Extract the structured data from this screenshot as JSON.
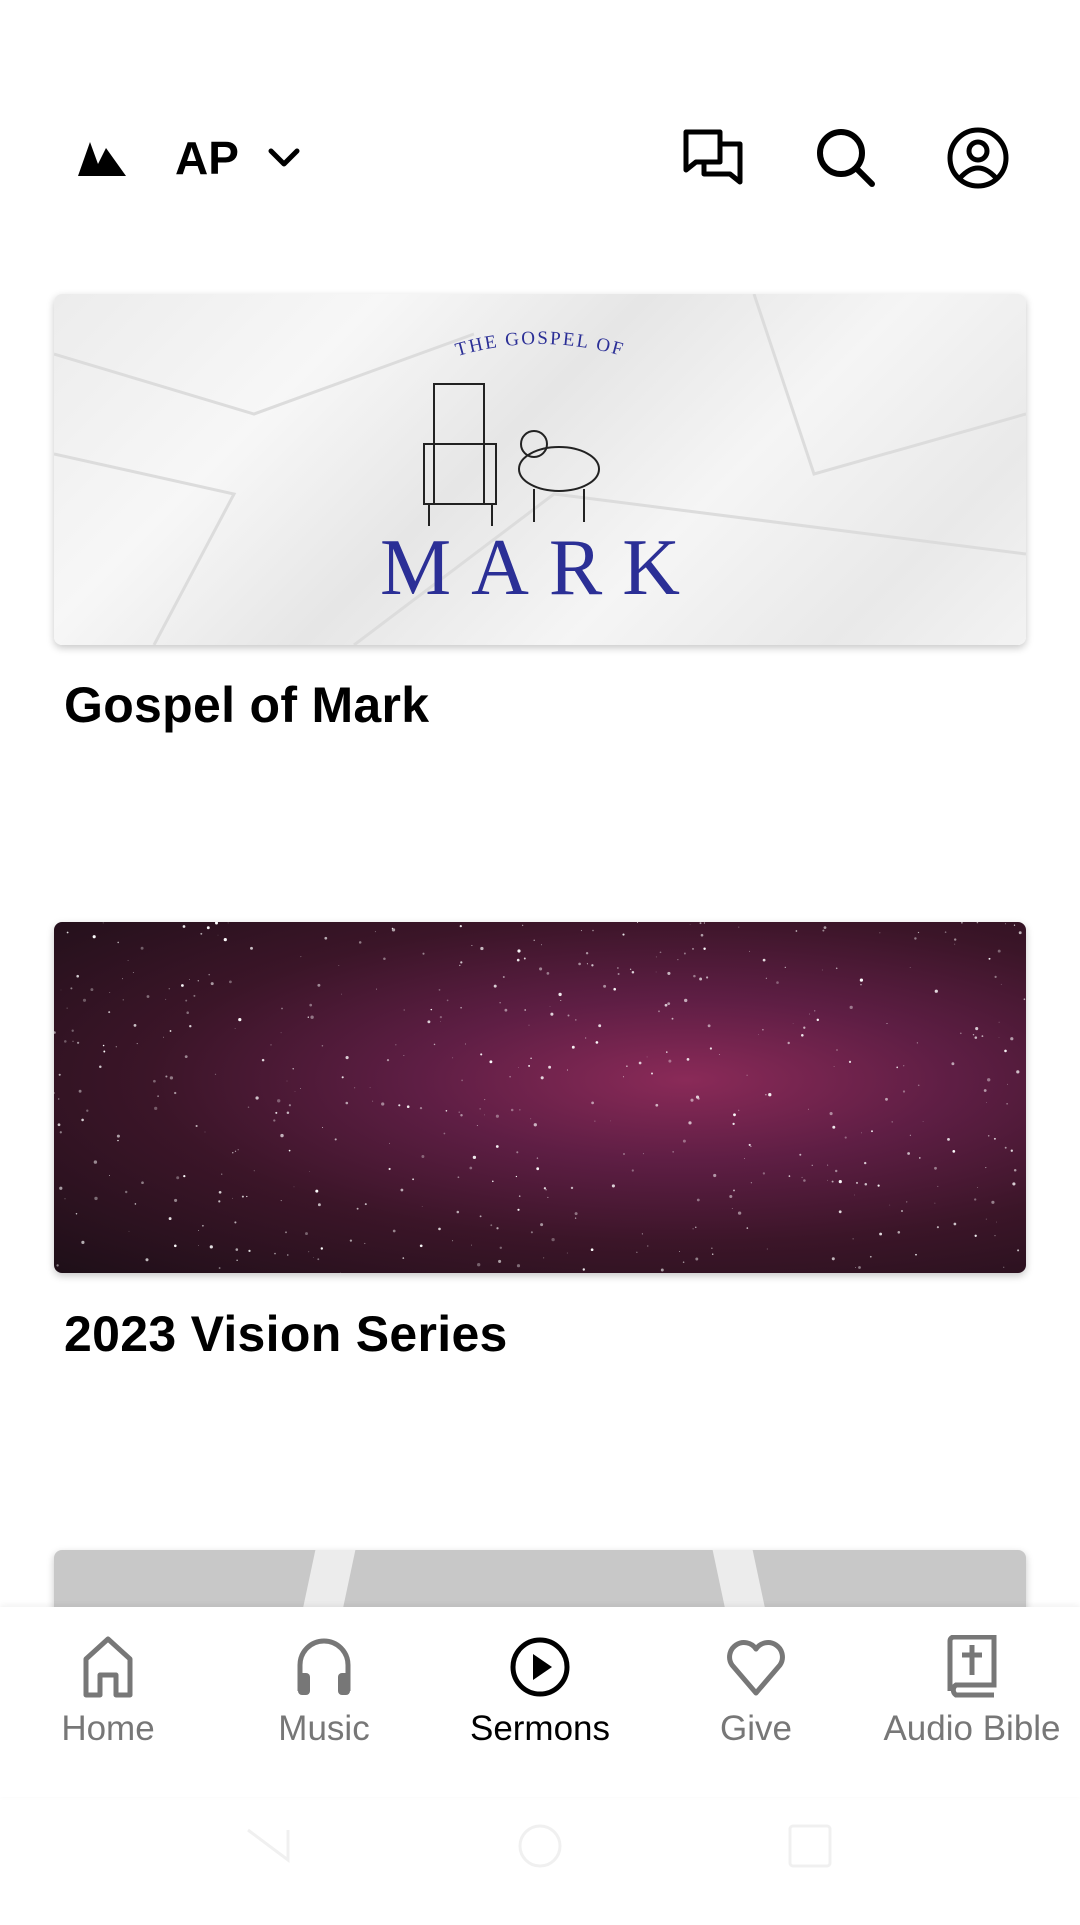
{
  "header": {
    "brand_label": "AP",
    "icons": [
      "mountain-logo-icon",
      "chevron-down-icon",
      "chat-icon",
      "search-icon",
      "profile-icon"
    ]
  },
  "series": [
    {
      "title": "Gospel of Mark",
      "artwork": {
        "subtitle": "THE GOSPEL OF",
        "title": "MARK",
        "color": "#2b2f96"
      }
    },
    {
      "title": "2023 Vision Series"
    },
    {
      "title": ""
    }
  ],
  "bottom_nav": {
    "active": "Sermons",
    "items": [
      {
        "label": "Home",
        "icon": "home-icon"
      },
      {
        "label": "Music",
        "icon": "headphones-icon"
      },
      {
        "label": "Sermons",
        "icon": "play-circle-icon"
      },
      {
        "label": "Give",
        "icon": "heart-icon"
      },
      {
        "label": "Audio Bible",
        "icon": "bible-icon"
      }
    ]
  }
}
